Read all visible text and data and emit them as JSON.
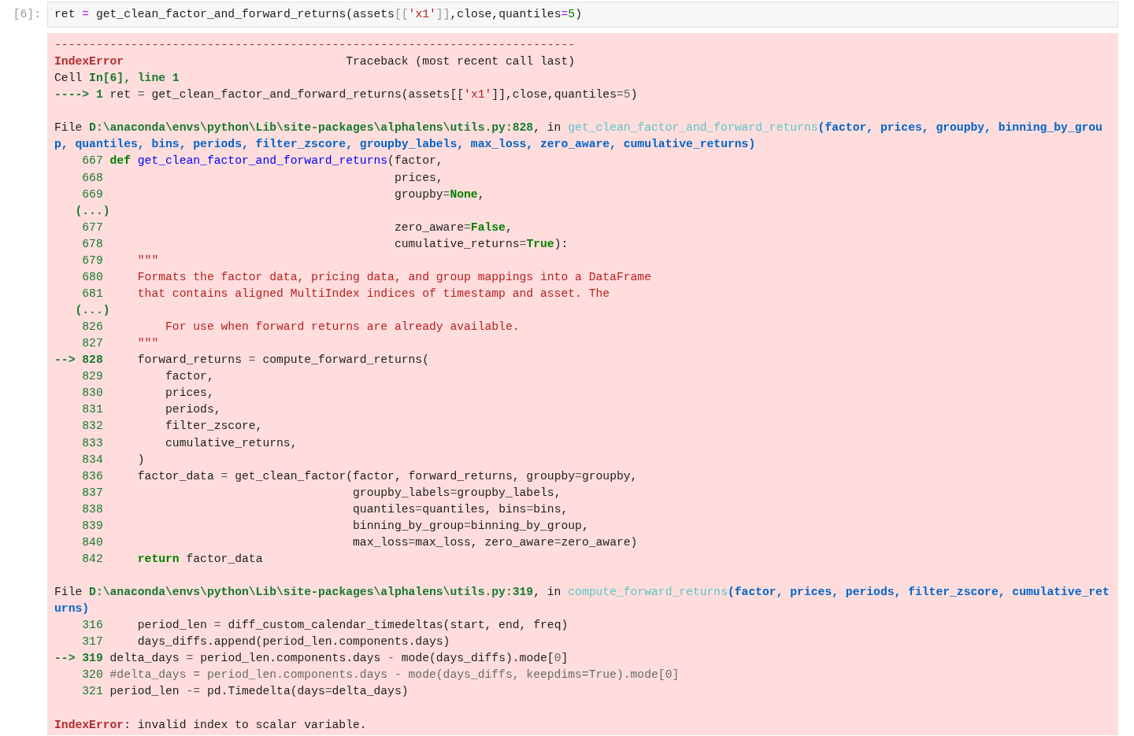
{
  "cell": {
    "prompt": "[6]:",
    "input": [
      {
        "kind": "plain",
        "text": "ret "
      },
      {
        "kind": "assign",
        "text": "="
      },
      {
        "kind": "plain",
        "text": " get_clean_factor_and_forward_returns(assets"
      },
      {
        "kind": "bracket",
        "text": "[["
      },
      {
        "kind": "str",
        "text": "'x1'"
      },
      {
        "kind": "bracket",
        "text": "]]"
      },
      {
        "kind": "plain",
        "text": ",close,quantiles"
      },
      {
        "kind": "assign",
        "text": "="
      },
      {
        "kind": "num",
        "text": "5"
      },
      {
        "kind": "plain",
        "text": ")"
      }
    ]
  },
  "output": {
    "lines": [
      {
        "kind": "code",
        "segments": [
          {
            "kind": "dash",
            "text": "---------------------------------------------------------------------------"
          }
        ]
      },
      {
        "kind": "code",
        "segments": [
          {
            "kind": "err",
            "text": "IndexError"
          },
          {
            "kind": "plain",
            "text": "                                Traceback (most recent call last)"
          }
        ]
      },
      {
        "kind": "code",
        "segments": [
          {
            "kind": "plain",
            "text": "Cell "
          },
          {
            "kind": "green",
            "text": "In[6], line 1"
          }
        ]
      },
      {
        "kind": "code",
        "segments": [
          {
            "kind": "green",
            "text": "----> 1"
          },
          {
            "kind": "plain",
            "text": " ret "
          },
          {
            "kind": "op",
            "text": "="
          },
          {
            "kind": "plain",
            "text": " get_clean_factor_and_forward_returns(assets[["
          },
          {
            "kind": "str",
            "text": "'x1'"
          },
          {
            "kind": "plain",
            "text": "]],close,quantiles"
          },
          {
            "kind": "op",
            "text": "="
          },
          {
            "kind": "op",
            "text": "5"
          },
          {
            "kind": "plain",
            "text": ")"
          }
        ]
      },
      {
        "kind": "gap"
      },
      {
        "kind": "code",
        "segments": [
          {
            "kind": "plain",
            "text": "File "
          },
          {
            "kind": "green",
            "text": "D:\\anaconda\\envs\\python\\Lib\\site-packages\\alphalens\\utils.py:828"
          },
          {
            "kind": "plain",
            "text": ", in "
          },
          {
            "kind": "link",
            "text": "get_clean_factor_and_forward_returns"
          },
          {
            "kind": "arg",
            "text": "(factor, prices, groupby, binning_by_grou"
          }
        ]
      },
      {
        "kind": "code",
        "segments": [
          {
            "kind": "arg",
            "text": "p, quantiles, bins, periods, filter_zscore, groupby_labels, max_loss, zero_aware, cumulative_returns)"
          }
        ]
      },
      {
        "kind": "code",
        "segments": [
          {
            "kind": "lineno",
            "text": "    667 "
          },
          {
            "kind": "kw",
            "text": "def"
          },
          {
            "kind": "fn",
            "text": " get_clean_factor_and_forward_returns"
          },
          {
            "kind": "plain",
            "text": "(factor,"
          }
        ]
      },
      {
        "kind": "code",
        "segments": [
          {
            "kind": "lineno",
            "text": "    668 "
          },
          {
            "kind": "plain",
            "text": "                                         prices,"
          }
        ]
      },
      {
        "kind": "code",
        "segments": [
          {
            "kind": "lineno",
            "text": "    669 "
          },
          {
            "kind": "plain",
            "text": "                                         groupby"
          },
          {
            "kind": "op",
            "text": "="
          },
          {
            "kind": "kw",
            "text": "None"
          },
          {
            "kind": "plain",
            "text": ","
          }
        ]
      },
      {
        "kind": "code",
        "segments": [
          {
            "kind": "green",
            "text": "   (...)"
          }
        ]
      },
      {
        "kind": "code",
        "segments": [
          {
            "kind": "lineno",
            "text": "    677 "
          },
          {
            "kind": "plain",
            "text": "                                         zero_aware"
          },
          {
            "kind": "op",
            "text": "="
          },
          {
            "kind": "kw",
            "text": "False"
          },
          {
            "kind": "plain",
            "text": ","
          }
        ]
      },
      {
        "kind": "code",
        "segments": [
          {
            "kind": "lineno",
            "text": "    678 "
          },
          {
            "kind": "plain",
            "text": "                                         cumulative_returns"
          },
          {
            "kind": "op",
            "text": "="
          },
          {
            "kind": "kw",
            "text": "True"
          },
          {
            "kind": "plain",
            "text": "):"
          }
        ]
      },
      {
        "kind": "code",
        "segments": [
          {
            "kind": "lineno",
            "text": "    679 "
          },
          {
            "kind": "str",
            "text": "    \"\"\""
          }
        ]
      },
      {
        "kind": "code",
        "segments": [
          {
            "kind": "lineno",
            "text": "    680 "
          },
          {
            "kind": "str",
            "text": "    Formats the factor data, pricing data, and group mappings into a DataFrame"
          }
        ]
      },
      {
        "kind": "code",
        "segments": [
          {
            "kind": "lineno",
            "text": "    681 "
          },
          {
            "kind": "str",
            "text": "    that contains aligned MultiIndex indices of timestamp and asset. The"
          }
        ]
      },
      {
        "kind": "code",
        "segments": [
          {
            "kind": "green",
            "text": "   (...)"
          }
        ]
      },
      {
        "kind": "code",
        "segments": [
          {
            "kind": "lineno",
            "text": "    826 "
          },
          {
            "kind": "str",
            "text": "        For use when forward returns are already available."
          }
        ]
      },
      {
        "kind": "code",
        "segments": [
          {
            "kind": "lineno",
            "text": "    827 "
          },
          {
            "kind": "str",
            "text": "    \"\"\""
          }
        ]
      },
      {
        "kind": "code",
        "segments": [
          {
            "kind": "green",
            "text": "--> 828 "
          },
          {
            "kind": "plain",
            "text": "    forward_returns "
          },
          {
            "kind": "op",
            "text": "="
          },
          {
            "kind": "plain",
            "text": " compute_forward_returns("
          }
        ]
      },
      {
        "kind": "code",
        "segments": [
          {
            "kind": "lineno",
            "text": "    829 "
          },
          {
            "kind": "plain",
            "text": "        factor,"
          }
        ]
      },
      {
        "kind": "code",
        "segments": [
          {
            "kind": "lineno",
            "text": "    830 "
          },
          {
            "kind": "plain",
            "text": "        prices,"
          }
        ]
      },
      {
        "kind": "code",
        "segments": [
          {
            "kind": "lineno",
            "text": "    831 "
          },
          {
            "kind": "plain",
            "text": "        periods,"
          }
        ]
      },
      {
        "kind": "code",
        "segments": [
          {
            "kind": "lineno",
            "text": "    832 "
          },
          {
            "kind": "plain",
            "text": "        filter_zscore,"
          }
        ]
      },
      {
        "kind": "code",
        "segments": [
          {
            "kind": "lineno",
            "text": "    833 "
          },
          {
            "kind": "plain",
            "text": "        cumulative_returns,"
          }
        ]
      },
      {
        "kind": "code",
        "segments": [
          {
            "kind": "lineno",
            "text": "    834 "
          },
          {
            "kind": "plain",
            "text": "    )"
          }
        ]
      },
      {
        "kind": "code",
        "segments": [
          {
            "kind": "lineno",
            "text": "    836 "
          },
          {
            "kind": "plain",
            "text": "    factor_data "
          },
          {
            "kind": "op",
            "text": "="
          },
          {
            "kind": "plain",
            "text": " get_clean_factor(factor, forward_returns, groupby"
          },
          {
            "kind": "op",
            "text": "="
          },
          {
            "kind": "plain",
            "text": "groupby,"
          }
        ]
      },
      {
        "kind": "code",
        "segments": [
          {
            "kind": "lineno",
            "text": "    837 "
          },
          {
            "kind": "plain",
            "text": "                                   groupby_labels"
          },
          {
            "kind": "op",
            "text": "="
          },
          {
            "kind": "plain",
            "text": "groupby_labels,"
          }
        ]
      },
      {
        "kind": "code",
        "segments": [
          {
            "kind": "lineno",
            "text": "    838 "
          },
          {
            "kind": "plain",
            "text": "                                   quantiles"
          },
          {
            "kind": "op",
            "text": "="
          },
          {
            "kind": "plain",
            "text": "quantiles, bins"
          },
          {
            "kind": "op",
            "text": "="
          },
          {
            "kind": "plain",
            "text": "bins,"
          }
        ]
      },
      {
        "kind": "code",
        "segments": [
          {
            "kind": "lineno",
            "text": "    839 "
          },
          {
            "kind": "plain",
            "text": "                                   binning_by_group"
          },
          {
            "kind": "op",
            "text": "="
          },
          {
            "kind": "plain",
            "text": "binning_by_group,"
          }
        ]
      },
      {
        "kind": "code",
        "segments": [
          {
            "kind": "lineno",
            "text": "    840 "
          },
          {
            "kind": "plain",
            "text": "                                   max_loss"
          },
          {
            "kind": "op",
            "text": "="
          },
          {
            "kind": "plain",
            "text": "max_loss, zero_aware"
          },
          {
            "kind": "op",
            "text": "="
          },
          {
            "kind": "plain",
            "text": "zero_aware)"
          }
        ]
      },
      {
        "kind": "code",
        "segments": [
          {
            "kind": "lineno",
            "text": "    842     "
          },
          {
            "kind": "kw",
            "text": "return"
          },
          {
            "kind": "plain",
            "text": " factor_data"
          }
        ]
      },
      {
        "kind": "gap"
      },
      {
        "kind": "code",
        "segments": [
          {
            "kind": "plain",
            "text": "File "
          },
          {
            "kind": "green",
            "text": "D:\\anaconda\\envs\\python\\Lib\\site-packages\\alphalens\\utils.py:319"
          },
          {
            "kind": "plain",
            "text": ", in "
          },
          {
            "kind": "link",
            "text": "compute_forward_returns"
          },
          {
            "kind": "arg",
            "text": "(factor, prices, periods, filter_zscore, cumulative_ret"
          }
        ]
      },
      {
        "kind": "code",
        "segments": [
          {
            "kind": "arg",
            "text": "urns)"
          }
        ]
      },
      {
        "kind": "code",
        "segments": [
          {
            "kind": "lineno",
            "text": "    316 "
          },
          {
            "kind": "plain",
            "text": "    period_len "
          },
          {
            "kind": "op",
            "text": "="
          },
          {
            "kind": "plain",
            "text": " diff_custom_calendar_timedeltas(start, end, freq)"
          }
        ]
      },
      {
        "kind": "code",
        "segments": [
          {
            "kind": "lineno",
            "text": "    317 "
          },
          {
            "kind": "plain",
            "text": "    days_diffs.append(period_len.components.days)"
          }
        ]
      },
      {
        "kind": "code",
        "segments": [
          {
            "kind": "green",
            "text": "--> 319 "
          },
          {
            "kind": "plain",
            "text": "delta_days "
          },
          {
            "kind": "op",
            "text": "="
          },
          {
            "kind": "plain",
            "text": " period_len.components.days "
          },
          {
            "kind": "op",
            "text": "-"
          },
          {
            "kind": "plain",
            "text": " mode(days_diffs).mode["
          },
          {
            "kind": "op",
            "text": "0"
          },
          {
            "kind": "plain",
            "text": "]"
          }
        ]
      },
      {
        "kind": "code",
        "segments": [
          {
            "kind": "lineno",
            "text": "    320 "
          },
          {
            "kind": "comment",
            "text": "#delta_days = period_len.components.days - mode(days_diffs, keepdims=True).mode[0]"
          }
        ]
      },
      {
        "kind": "code",
        "segments": [
          {
            "kind": "lineno",
            "text": "    321 "
          },
          {
            "kind": "plain",
            "text": "period_len "
          },
          {
            "kind": "op",
            "text": "-="
          },
          {
            "kind": "plain",
            "text": " pd.Timedelta(days"
          },
          {
            "kind": "op",
            "text": "="
          },
          {
            "kind": "plain",
            "text": "delta_days)"
          }
        ]
      },
      {
        "kind": "gap"
      },
      {
        "kind": "code",
        "segments": [
          {
            "kind": "err",
            "text": "IndexError"
          },
          {
            "kind": "plain",
            "text": ": invalid index to scalar variable."
          }
        ]
      }
    ]
  }
}
